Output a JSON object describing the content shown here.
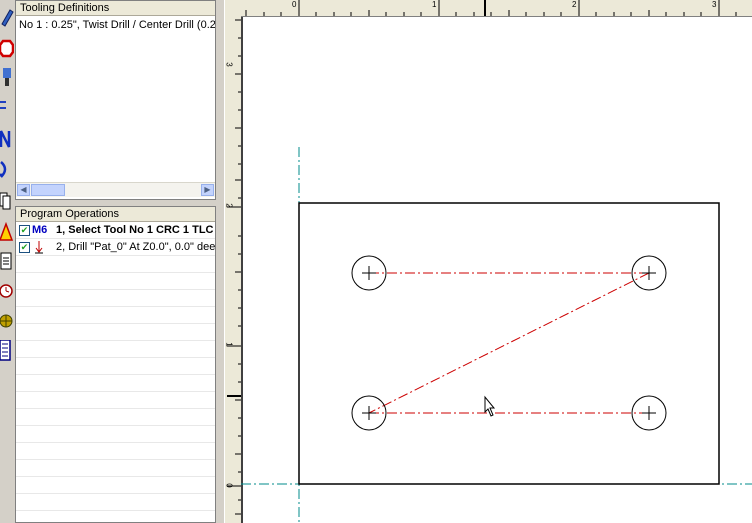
{
  "tooling": {
    "title": "Tooling Definitions",
    "tools": [
      "No 1 : 0.25\", Twist Drill / Center Drill (0.2"
    ]
  },
  "operations": {
    "title": "Program Operations",
    "items": [
      {
        "tag": "M6",
        "text": "1, Select Tool No 1 CRC 1 TLC",
        "checked": true
      },
      {
        "tag": "drill",
        "text": "2, Drill \"Pat_0\" At Z0.0\", 0.0\" dee",
        "checked": true
      }
    ]
  },
  "rulers": {
    "top_labels": [
      "0",
      "1",
      "2",
      "3"
    ],
    "left_labels": [
      "3",
      "2",
      "1",
      "0"
    ]
  },
  "toolbar_icons": [
    "pencil-icon",
    "stop-icon",
    "probe-icon",
    "arrow-icon",
    "n-icon",
    "arc-icon",
    "copy-icon",
    "warning-icon",
    "document-icon",
    "clock-icon",
    "globe-icon",
    "list-icon"
  ],
  "colors": {
    "centerline": "#008b8b",
    "toolpath": "#cc0000",
    "stock": "#000000"
  }
}
